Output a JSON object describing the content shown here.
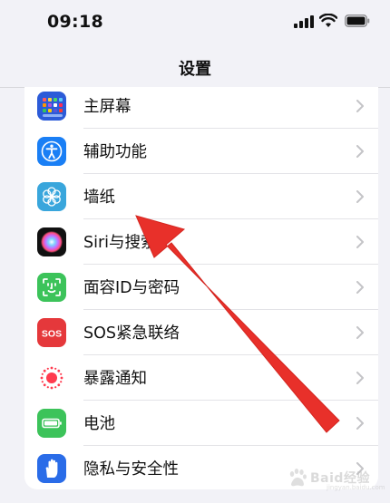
{
  "status_bar": {
    "time": "09:18"
  },
  "nav": {
    "title": "设置"
  },
  "settings_items": [
    {
      "label": "主屏幕",
      "icon": "home-screen-icon",
      "color": "#2c5bd8"
    },
    {
      "label": "辅助功能",
      "icon": "accessibility-icon",
      "color": "#1a7ff5"
    },
    {
      "label": "墙纸",
      "icon": "wallpaper-icon",
      "color": "#39a6dc"
    },
    {
      "label": "Siri与搜索",
      "icon": "siri-icon",
      "color": "#111111"
    },
    {
      "label": "面容ID与密码",
      "icon": "face-id-icon",
      "color": "#3cc35a"
    },
    {
      "label": "SOS紧急联络",
      "icon": "sos-icon",
      "color": "#e5383b"
    },
    {
      "label": "暴露通知",
      "icon": "exposure-notification-icon",
      "color": "#ffffff"
    },
    {
      "label": "电池",
      "icon": "battery-icon",
      "color": "#3cc35a"
    },
    {
      "label": "隐私与安全性",
      "icon": "privacy-hand-icon",
      "color": "#2a6ce8"
    }
  ],
  "annotation": {
    "arrow_color": "#e8302a",
    "points_to": "墙纸"
  },
  "watermark": {
    "text": "Baid经验",
    "sub": "jingyan.baidu.com"
  }
}
